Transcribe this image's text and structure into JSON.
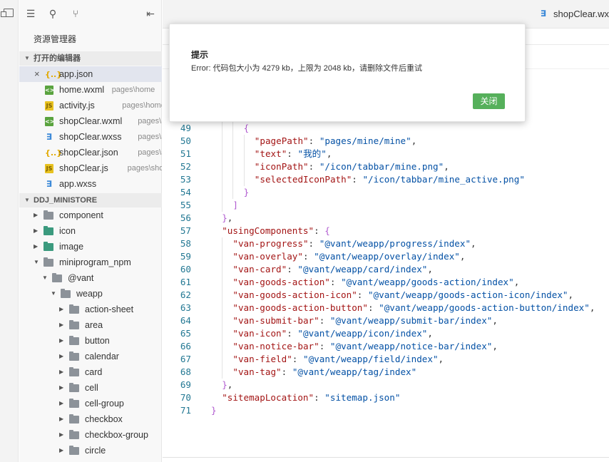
{
  "sidebar": {
    "title": "资源管理器",
    "open_editors_header": "打开的编辑器",
    "open_editors": [
      {
        "name": "app.json",
        "desc": "",
        "icon": "json-file-icon",
        "active": true
      },
      {
        "name": "home.wxml",
        "desc": "pages\\home",
        "icon": "wxml-file-icon"
      },
      {
        "name": "activity.js",
        "desc": "pages\\home\\a...",
        "icon": "js-file-icon"
      },
      {
        "name": "shopClear.wxml",
        "desc": "pages\\...",
        "icon": "wxml-file-icon"
      },
      {
        "name": "shopClear.wxss",
        "desc": "pages\\s...",
        "icon": "wxss-file-icon"
      },
      {
        "name": "shopClear.json",
        "desc": "pages\\s...",
        "icon": "json-file-icon"
      },
      {
        "name": "shopClear.js",
        "desc": "pages\\sho...",
        "icon": "js-file-icon"
      },
      {
        "name": "app.wxss",
        "desc": "",
        "icon": "wxss-file-icon"
      }
    ],
    "project_header": "DDJ_MINISTORE",
    "tree": [
      {
        "name": "component",
        "expanded": false,
        "folder_icon": "folder-icon"
      },
      {
        "name": "icon",
        "expanded": false,
        "folder_icon": "image-folder-icon"
      },
      {
        "name": "image",
        "expanded": false,
        "folder_icon": "image-folder-icon"
      },
      {
        "name": "miniprogram_npm",
        "expanded": true,
        "folder_icon": "folder-open-icon"
      },
      {
        "name": "@vant",
        "expanded": true,
        "folder_icon": "folder-open-icon"
      },
      {
        "name": "weapp",
        "expanded": true,
        "folder_icon": "folder-open-icon"
      },
      {
        "name": "action-sheet",
        "expanded": false,
        "folder_icon": "folder-icon"
      },
      {
        "name": "area",
        "expanded": false,
        "folder_icon": "folder-icon"
      },
      {
        "name": "button",
        "expanded": false,
        "folder_icon": "folder-icon"
      },
      {
        "name": "calendar",
        "expanded": false,
        "folder_icon": "folder-icon"
      },
      {
        "name": "card",
        "expanded": false,
        "folder_icon": "folder-icon"
      },
      {
        "name": "cell",
        "expanded": false,
        "folder_icon": "folder-icon"
      },
      {
        "name": "cell-group",
        "expanded": false,
        "folder_icon": "folder-icon"
      },
      {
        "name": "checkbox",
        "expanded": false,
        "folder_icon": "folder-icon"
      },
      {
        "name": "checkbox-group",
        "expanded": false,
        "folder_icon": "folder-icon"
      },
      {
        "name": "circle",
        "expanded": false,
        "folder_icon": "folder-icon"
      }
    ]
  },
  "editor": {
    "tab_label": "shopClear.wxs",
    "lines": [
      {
        "n": "49",
        "t": "{"
      },
      {
        "n": "50",
        "t": "\"pagePath\": \"pages/mine/mine\","
      },
      {
        "n": "51",
        "t": "\"text\": \"我的\","
      },
      {
        "n": "52",
        "t": "\"iconPath\": \"/icon/tabbar/mine.png\","
      },
      {
        "n": "53",
        "t": "\"selectedIconPath\": \"/icon/tabbar/mine_active.png\""
      },
      {
        "n": "54",
        "t": "}"
      },
      {
        "n": "55",
        "t": "]"
      },
      {
        "n": "56",
        "t": "},"
      },
      {
        "n": "57",
        "t": "\"usingComponents\": {"
      },
      {
        "n": "58",
        "t": "\"van-progress\": \"@vant/weapp/progress/index\","
      },
      {
        "n": "59",
        "t": "\"van-overlay\": \"@vant/weapp/overlay/index\","
      },
      {
        "n": "60",
        "t": "\"van-card\": \"@vant/weapp/card/index\","
      },
      {
        "n": "61",
        "t": "\"van-goods-action\": \"@vant/weapp/goods-action/index\","
      },
      {
        "n": "62",
        "t": "\"van-goods-action-icon\": \"@vant/weapp/goods-action-icon/index\","
      },
      {
        "n": "63",
        "t": "\"van-goods-action-button\": \"@vant/weapp/goods-action-button/index\","
      },
      {
        "n": "64",
        "t": "\"van-submit-bar\": \"@vant/weapp/submit-bar/index\","
      },
      {
        "n": "65",
        "t": "\"van-icon\": \"@vant/weapp/icon/index\","
      },
      {
        "n": "66",
        "t": "\"van-notice-bar\": \"@vant/weapp/notice-bar/index\","
      },
      {
        "n": "67",
        "t": "\"van-field\": \"@vant/weapp/field/index\","
      },
      {
        "n": "68",
        "t": "\"van-tag\": \"@vant/weapp/tag/index\""
      },
      {
        "n": "69",
        "t": "},"
      },
      {
        "n": "70",
        "t": "\"sitemapLocation\": \"sitemap.json\""
      },
      {
        "n": "71",
        "t": "}"
      }
    ]
  },
  "dialog": {
    "title": "提示",
    "message": "Error: 代码包大小为 4279 kb，上限为 2048 kb，请删除文件后重试",
    "close_label": "关闭",
    "button_color": "#56b05b"
  },
  "colors": {
    "key": "#a31515",
    "string": "#0451a5",
    "line_number": "#237893",
    "active_row": "#e2e5ee"
  }
}
